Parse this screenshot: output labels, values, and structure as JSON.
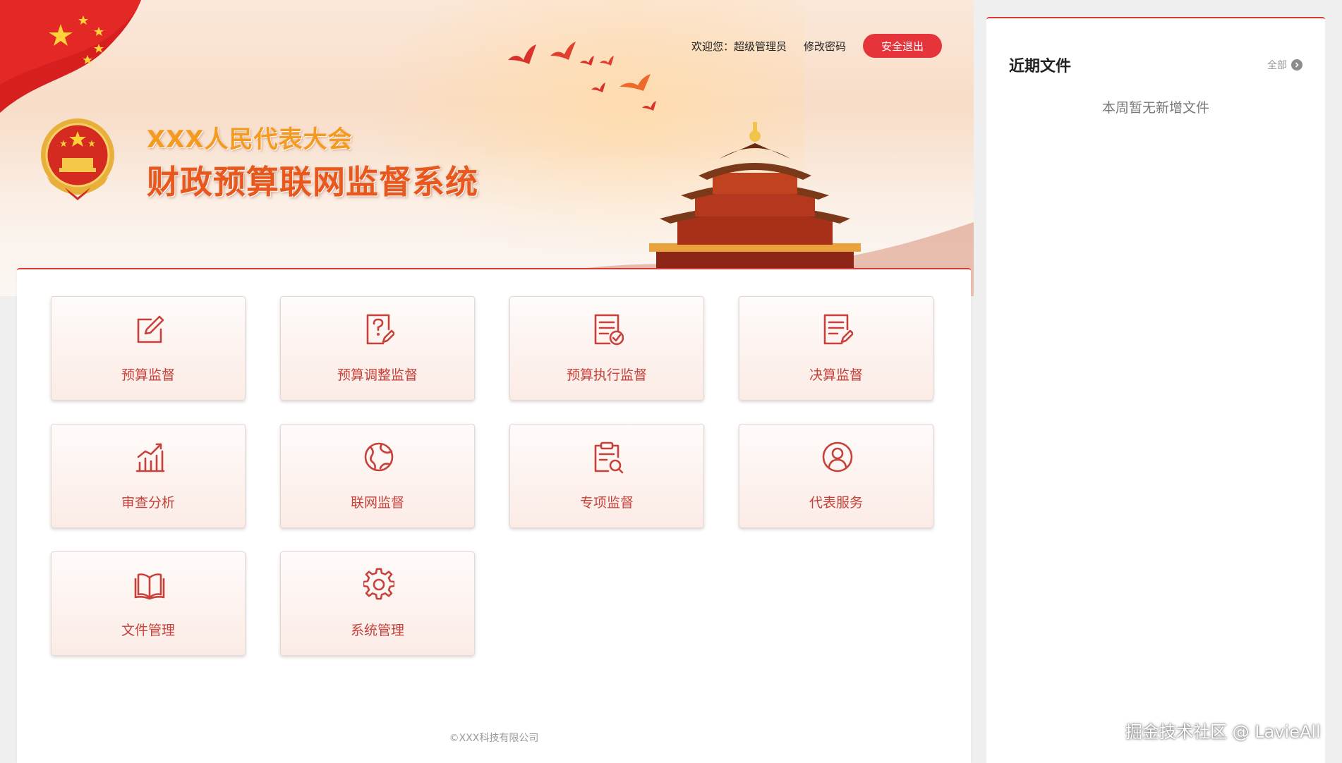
{
  "header": {
    "title_line1": "XXX人民代表大会",
    "title_line2": "财政预算联网监督系统",
    "welcome": "欢迎您：超级管理员",
    "change_password": "修改密码",
    "logout": "安全退出"
  },
  "modules": [
    {
      "label": "预算监督",
      "icon": "edit-square-icon"
    },
    {
      "label": "预算调整监督",
      "icon": "question-document-icon"
    },
    {
      "label": "预算执行监督",
      "icon": "checked-document-icon"
    },
    {
      "label": "决算监督",
      "icon": "document-pen-icon"
    },
    {
      "label": "审查分析",
      "icon": "bar-chart-icon"
    },
    {
      "label": "联网监督",
      "icon": "globe-icon"
    },
    {
      "label": "专项监督",
      "icon": "clipboard-search-icon"
    },
    {
      "label": "代表服务",
      "icon": "user-circle-icon"
    },
    {
      "label": "文件管理",
      "icon": "open-book-icon"
    },
    {
      "label": "系统管理",
      "icon": "gear-icon"
    }
  ],
  "footer": "©XXX科技有限公司",
  "recent_files": {
    "title": "近期文件",
    "all_link": "全部",
    "empty_message": "本周暂无新增文件"
  },
  "watermark": "掘金技术社区 @ LavieAll",
  "colors": {
    "accent": "#d83a34",
    "button": "#e6343b",
    "tile_text": "#c8403a"
  }
}
